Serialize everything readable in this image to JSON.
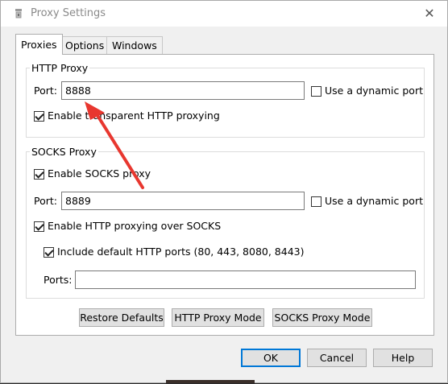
{
  "window": {
    "title": "Proxy Settings"
  },
  "tabs": [
    "Proxies",
    "Options",
    "Windows"
  ],
  "http_proxy": {
    "legend": "HTTP Proxy",
    "port_label": "Port:",
    "port_value": "8888",
    "dynamic_port_label": "Use a dynamic port",
    "dynamic_port_checked": false,
    "transparent_label": "Enable transparent HTTP proxying",
    "transparent_checked": true
  },
  "socks_proxy": {
    "legend": "SOCKS Proxy",
    "enable_label": "Enable SOCKS proxy",
    "enable_checked": true,
    "port_label": "Port:",
    "port_value": "8889",
    "dynamic_port_label": "Use a dynamic port",
    "dynamic_port_checked": false,
    "http_over_socks_label": "Enable HTTP proxying over SOCKS",
    "http_over_socks_checked": true,
    "default_ports_label": "Include default HTTP ports (80, 443, 8080, 8443)",
    "default_ports_checked": true,
    "ports_label": "Ports:",
    "ports_value": ""
  },
  "panel_buttons": {
    "restore_defaults": "Restore Defaults",
    "http_proxy_mode": "HTTP Proxy Mode",
    "socks_proxy_mode": "SOCKS Proxy Mode"
  },
  "dialog_buttons": {
    "ok": "OK",
    "cancel": "Cancel",
    "help": "Help"
  },
  "annotation": {
    "arrow_color": "#e8372f"
  },
  "icons": {
    "close": "close-icon",
    "app": "app-icon"
  }
}
